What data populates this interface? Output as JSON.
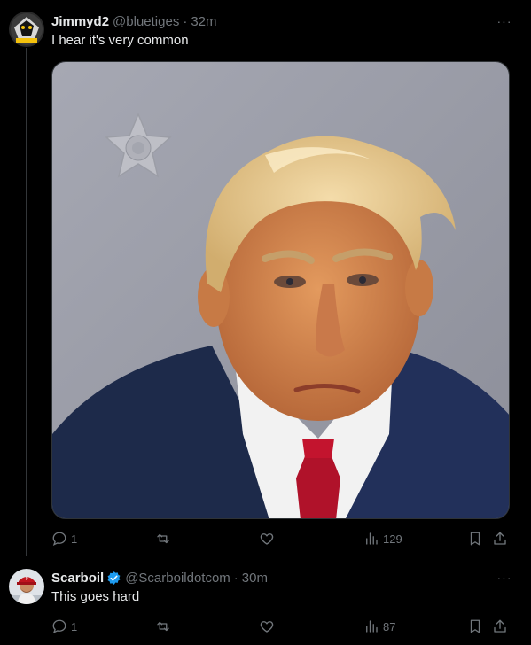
{
  "tweets": [
    {
      "display_name": "Jimmyd2",
      "handle": "@bluetiges",
      "separator": "·",
      "time": "32m",
      "text": "I hear it's very common",
      "more_label": "···",
      "media_alt": "Mugshot photo",
      "actions": {
        "replies": "1",
        "reposts": "",
        "likes": "",
        "views": "129"
      }
    },
    {
      "display_name": "Scarboil",
      "handle": "@Scarboildotcom",
      "separator": "·",
      "time": "30m",
      "text": "This goes hard",
      "verified": true,
      "more_label": "···",
      "actions": {
        "replies": "1",
        "reposts": "",
        "likes": "",
        "views": "87"
      }
    }
  ],
  "colors": {
    "background": "#000000",
    "text_primary": "#e7e9ea",
    "text_secondary": "#71767b",
    "verified": "#1d9bf0",
    "divider": "#2f3336"
  }
}
